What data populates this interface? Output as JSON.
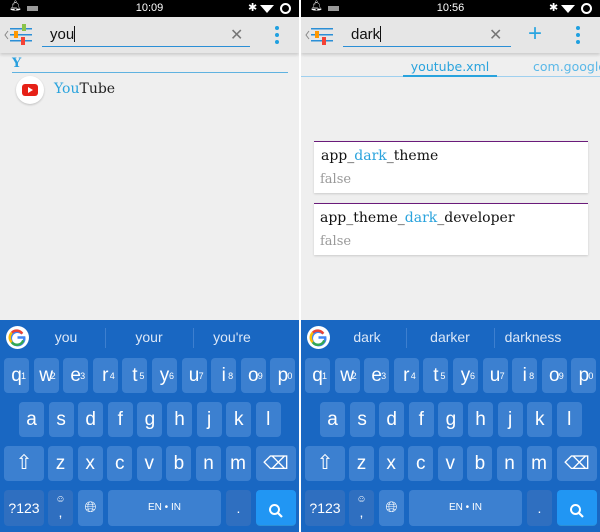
{
  "colors": {
    "accent": "#29a3dd",
    "keyboard_bg": "#1967c2",
    "key_bg": "#3c80d0",
    "search_key": "#2196f3",
    "card_border": "#6a1b7a"
  },
  "panels": [
    {
      "status": {
        "time": "10:09"
      },
      "search": {
        "value": "you"
      },
      "section_header": "Y",
      "app": {
        "highlight": "You",
        "rest": "Tube",
        "icon": "youtube-icon"
      },
      "suggestions": [
        "you",
        "your",
        "you're"
      ]
    },
    {
      "status": {
        "time": "10:56"
      },
      "search": {
        "value": "dark"
      },
      "tabs": [
        {
          "label": "youtube.xml",
          "active": true
        },
        {
          "label": "com.google.",
          "active": false
        }
      ],
      "prefs": [
        {
          "before": "app_",
          "match": "dark",
          "after": "_theme",
          "value": "false"
        },
        {
          "before": "app_theme_",
          "match": "dark",
          "after": "_developer",
          "value": "false"
        }
      ],
      "suggestions": [
        "dark",
        "darker",
        "darkness"
      ]
    }
  ],
  "keyboard": {
    "row1": [
      "q",
      "w",
      "e",
      "r",
      "t",
      "y",
      "u",
      "i",
      "o",
      "p"
    ],
    "row1_hints": [
      "1",
      "2",
      "3",
      "4",
      "5",
      "6",
      "7",
      "8",
      "9",
      "0"
    ],
    "row2": [
      "a",
      "s",
      "d",
      "f",
      "g",
      "h",
      "j",
      "k",
      "l"
    ],
    "row3": [
      "z",
      "x",
      "c",
      "v",
      "b",
      "n",
      "m"
    ],
    "symbols_label": "?123",
    "comma": ",",
    "space_label": "EN • IN",
    "period": "."
  }
}
